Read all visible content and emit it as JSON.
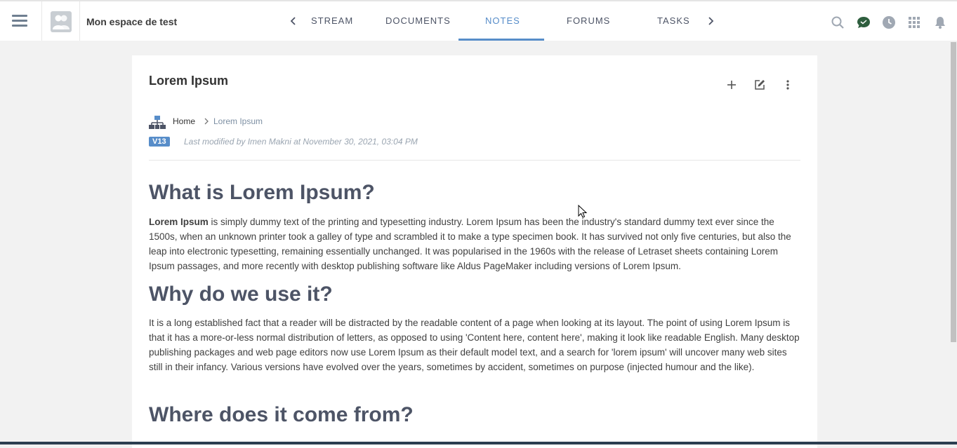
{
  "header": {
    "space_name": "Mon espace de test",
    "tabs": [
      {
        "label": "STREAM"
      },
      {
        "label": "DOCUMENTS"
      },
      {
        "label": "NOTES",
        "active": true
      },
      {
        "label": "FORUMS"
      },
      {
        "label": "TASKS"
      }
    ],
    "icons": [
      "menu-icon",
      "chevron-left-icon",
      "chevron-right-icon",
      "search-icon",
      "chat-icon",
      "clock-icon",
      "apps-grid-icon",
      "bell-icon"
    ]
  },
  "note": {
    "title": "Lorem Ipsum",
    "actions": [
      "add-icon",
      "edit-icon",
      "more-vertical-icon"
    ],
    "breadcrumb": {
      "home": "Home",
      "current": "Lorem Ipsum"
    },
    "version": "V13",
    "last_modified": "Last modified by Imen Makni at November 30, 2021, 03:04 PM"
  },
  "content": {
    "h1": "What is Lorem Ipsum?",
    "p1_bold": "Lorem Ipsum",
    "p1_rest": " is simply dummy text of the printing and typesetting industry. Lorem Ipsum has been the industry's standard dummy text ever since the 1500s, when an unknown printer took a galley of type and scrambled it to make a type specimen book. It has survived not only five centuries, but also the leap into electronic typesetting, remaining essentially unchanged. It was popularised in the 1960s with the release of Letraset sheets containing Lorem Ipsum passages, and more recently with desktop publishing software like Aldus PageMaker including versions of Lorem Ipsum.",
    "h2": "Why do we use it?",
    "p2": "It is a long established fact that a reader will be distracted by the readable content of a page when looking at its layout. The point of using Lorem Ipsum is that it has a more-or-less normal distribution of letters, as opposed to using 'Content here, content here', making it look like readable English. Many desktop publishing packages and web page editors now use Lorem Ipsum as their default model text, and a search for 'lorem ipsum' will uncover many web sites still in their infancy. Various versions have evolved over the years, sometimes by accident, sometimes on purpose (injected humour and the like).",
    "h3": "Where does it come from?"
  },
  "colors": {
    "accent": "#578dc9",
    "heading": "#4d5466",
    "background": "#f2f2f2"
  }
}
